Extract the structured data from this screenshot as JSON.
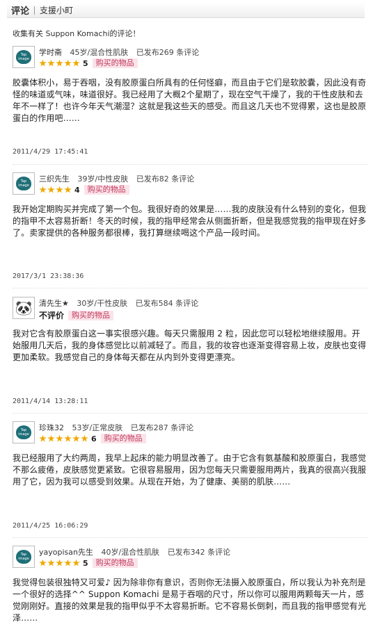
{
  "header": {
    "tab": "评论",
    "sub": "支援小町"
  },
  "intro": "收集有关 Suppon Komachi的评论！",
  "reviews": [
    {
      "user": "学时斋",
      "age_skin": "45岁/混合性肌肤",
      "posted": "已发布269 条评论",
      "stars": 5,
      "score": "5",
      "tag": "购买的物品",
      "body": "胶囊体积小，易于吞咽，没有胶原蛋白所具有的任何怪癖，而且由于它们是软胶囊，因此没有奇怪的味道或气味，味道很好。我已经用了大概2个星期了，现在空气干燥了，我的干性皮肤和去年不一样了！也许今年天气潮湿？这就是我这些天的感受。而且这几天也不觉得累，这也是胶原蛋白的作用吧……",
      "date": "2011/4/29 17:45:41"
    },
    {
      "user": "三织先生",
      "age_skin": "39岁/中性皮肤",
      "posted": "已发布82 条评论",
      "stars": 4,
      "score": "4",
      "tag": "购买的物品",
      "body": "我开始定期购买并完成了第一个包。我很好奇的效果是……我的皮肤没有什么特别的变化，但我的指甲不太容易折断！冬天的时候，我的指甲经常会从侧面折断，但是我感觉我的指甲现在好多了。卖家提供的各种服务都很棒，我打算继续喝这个产品一段时间。",
      "date": "2017/3/1 23:38:36"
    },
    {
      "user": "清先生★",
      "age_skin": "30岁/干性皮肤",
      "posted": "已发布584 条评论",
      "stars": 0,
      "score": "",
      "label": "不评价",
      "tag": "购买的物品",
      "body": "我对它含有胶原蛋白这一事实很感兴趣。每天只需服用 2 粒，因此您可以轻松地继续服用。开始服用几天后，我的身体感觉比以前减轻了。而且，我的妆容也逐渐变得容易上妆，皮肤也变得更加柔软。我感觉自己的身体每天都在从内到外变得更漂亮。",
      "date": "2011/4/14 13:28:11"
    },
    {
      "user": "珍珠32",
      "age_skin": "53岁/正常皮肤",
      "posted": "已发布287 条评论",
      "stars": 6,
      "score": "6",
      "tag": "购买的物品",
      "body": "我已经服用了大约两周，我早上起床的能力明显改善了。由于它含有氨基酸和胶原蛋白，我感觉不那么疲倦，皮肤感觉更紧致。它很容易服用，因为您每天只需要服用两片，我真的很高兴我服用了它，因为我可以感受到效果。从现在开始，为了健康、美丽的肌肤……",
      "date": "2011/4/25 16:06:29"
    },
    {
      "user": "yayopisan先生",
      "age_skin": "40岁/混合性肌肤",
      "posted": "已发布342 条评论",
      "stars": 5,
      "score": "5",
      "tag": "购买的物品",
      "body": "我觉得包装很独特又可爱♪ 因为除非你有意识，否则你无法摄入胶原蛋白，所以我认为补充剂是一个很好的选择^^ Suppon Komachi 是易于吞咽的尺寸，所以你可以服用两颗每天一片，感觉刚刚好。直接的效果是我的指甲似乎不太容易折断。它不容易长倒刺，而且我的指甲感觉有光泽……",
      "date": ""
    }
  ]
}
